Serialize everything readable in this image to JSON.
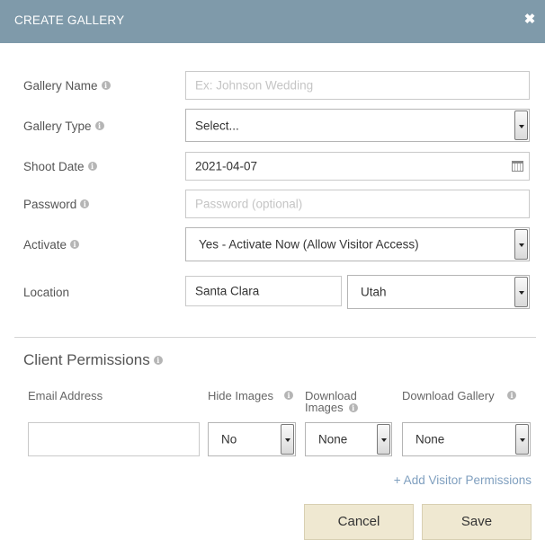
{
  "header": {
    "title": "CREATE GALLERY",
    "close_glyph": "✖"
  },
  "form": {
    "gallery_name": {
      "label": "Gallery Name",
      "placeholder": "Ex: Johnson Wedding",
      "value": ""
    },
    "gallery_type": {
      "label": "Gallery Type",
      "value": "Select..."
    },
    "shoot_date": {
      "label": "Shoot Date",
      "value": "2021-04-07"
    },
    "password": {
      "label": "Password",
      "placeholder": "Password (optional)",
      "value": ""
    },
    "activate": {
      "label": "Activate",
      "value": "Yes - Activate Now (Allow Visitor Access)"
    },
    "location": {
      "label": "Location",
      "city": "Santa Clara",
      "state": "Utah"
    }
  },
  "permissions": {
    "title": "Client Permissions",
    "columns": {
      "email": "Email Address",
      "hide_images": "Hide Images",
      "download_images_line1": "Download",
      "download_images_line2": "Images",
      "download_gallery": "Download Gallery"
    },
    "row": {
      "email": "",
      "hide_images": "No",
      "download_images": "None",
      "download_gallery": "None"
    },
    "add_link": "+ Add Visitor Permissions"
  },
  "footer": {
    "cancel": "Cancel",
    "save": "Save"
  },
  "info_glyph": "i",
  "colors": {
    "header_bg": "#7f9aaa",
    "button_bg": "#efe8d1",
    "link": "#7f9fbf"
  }
}
